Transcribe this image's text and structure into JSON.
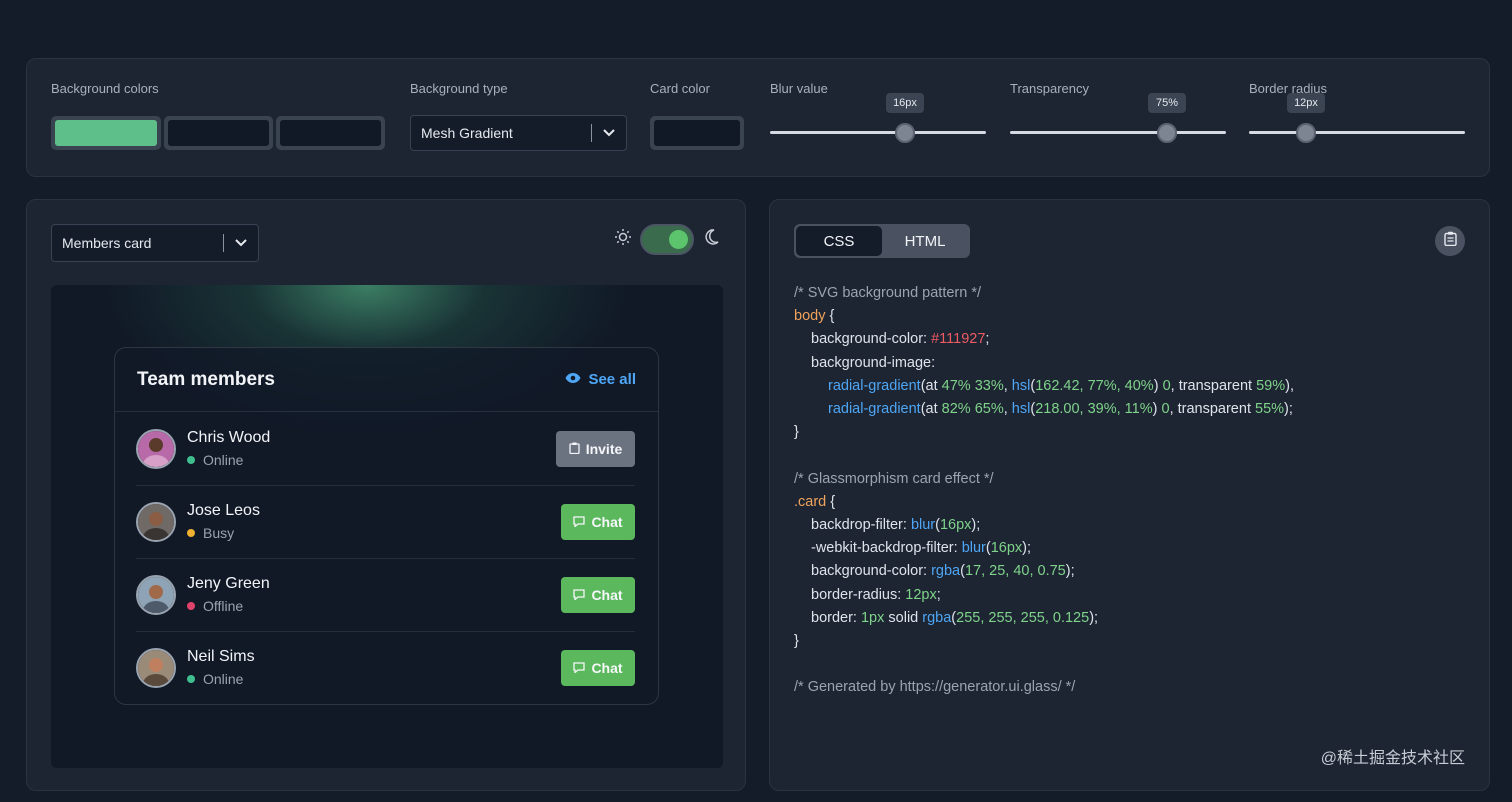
{
  "controls": {
    "background_colors_label": "Background colors",
    "background_colors": [
      "#5fbf8a",
      "#111927",
      "#111927"
    ],
    "background_type_label": "Background type",
    "background_type_value": "Mesh Gradient",
    "card_color_label": "Card color",
    "card_color": "#111927",
    "blur_label": "Blur value",
    "blur_value": "16px",
    "blur_fraction": 0.62,
    "transparency_label": "Transparency",
    "transparency_value": "75%",
    "transparency_fraction": 0.73,
    "radius_label": "Border radius",
    "radius_value": "12px",
    "radius_fraction": 0.26
  },
  "preview": {
    "template_select": "Members card",
    "dark_mode": true,
    "card": {
      "title": "Team members",
      "see_all": "See all",
      "members": [
        {
          "name": "Chris Wood",
          "status": "Online",
          "status_color": "#3fbf8f",
          "action": "Invite"
        },
        {
          "name": "Jose Leos",
          "status": "Busy",
          "status_color": "#f0b030",
          "action": "Chat"
        },
        {
          "name": "Jeny Green",
          "status": "Offline",
          "status_color": "#e0436a",
          "action": "Chat"
        },
        {
          "name": "Neil Sims",
          "status": "Online",
          "status_color": "#3fbf8f",
          "action": "Chat"
        }
      ]
    }
  },
  "code_panel": {
    "tab_css": "CSS",
    "tab_html": "HTML",
    "active_tab": "CSS",
    "lines": {
      "c1": "/* SVG background pattern */",
      "body_sel": "body",
      "brace_open": " {",
      "bg_color_prop": "background-color: ",
      "bg_color_val": "#111927",
      "bg_image_prop": "background-image:",
      "rg1_fn": "radial-gradient",
      "rg1_a": "(at ",
      "rg1_b": "47% 33%",
      "rg1_c": ", ",
      "rg1_hsl": "hsl",
      "rg1_d": "(",
      "rg1_e": "162.42, 77%, 40%",
      "rg1_f": ") ",
      "rg1_g": "0",
      "rg1_h": ", transparent ",
      "rg1_i": "59%",
      "rg1_j": "),",
      "rg2_fn": "radial-gradient",
      "rg2_b": "82% 65%",
      "rg2_e": "218.00, 39%, 11%",
      "rg2_i": "55%",
      "rg2_j": ");",
      "brace_close": "}",
      "c2": "/* Glassmorphism card effect */",
      "card_sel": ".card",
      "bf_prop": "backdrop-filter: ",
      "blur_fn": "blur",
      "px16": "16px",
      "wbf_prop": "-webkit-backdrop-filter: ",
      "bgc_prop": "background-color: ",
      "rgba_fn": "rgba",
      "rgba1": "17, 25, 40, 0.75",
      "br_prop": "border-radius: ",
      "px12": "12px",
      "border_prop": "border: ",
      "px1": "1px",
      "solid": " solid ",
      "rgba2": "255, 255, 255, 0.125",
      "c3": "/* Generated by https://generator.ui.glass/ */"
    }
  },
  "watermark": "@稀土掘金技术社区"
}
